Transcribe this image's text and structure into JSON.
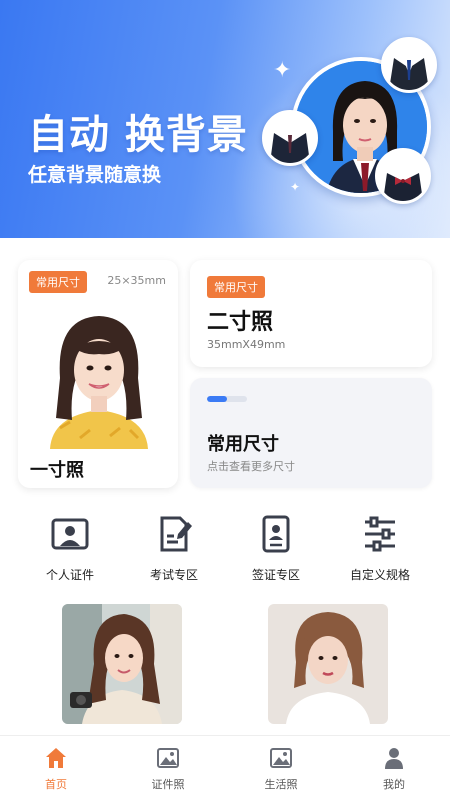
{
  "banner": {
    "title": "自动 换背景",
    "subtitle": "任意背景随意换"
  },
  "cards": {
    "one_inch": {
      "tag": "常用尺寸",
      "size": "25×35mm",
      "title": "一寸照"
    },
    "two_inch": {
      "tag": "常用尺寸",
      "title": "二寸照",
      "size": "35mmX49mm"
    },
    "common": {
      "title": "常用尺寸",
      "subtitle": "点击查看更多尺寸",
      "progress": 0.5
    }
  },
  "quick_entries": [
    {
      "label": "个人证件",
      "icon": "id-photo-icon"
    },
    {
      "label": "考试专区",
      "icon": "exam-icon"
    },
    {
      "label": "签证专区",
      "icon": "visa-icon"
    },
    {
      "label": "自定义规格",
      "icon": "custom-size-icon"
    }
  ],
  "tabbar": [
    {
      "label": "首页",
      "icon": "home-icon",
      "active": true
    },
    {
      "label": "证件照",
      "icon": "image-icon",
      "active": false
    },
    {
      "label": "生活照",
      "icon": "image-icon",
      "active": false
    },
    {
      "label": "我的",
      "icon": "user-icon",
      "active": false
    }
  ],
  "colors": {
    "accent": "#f07a3a",
    "primary_blue": "#3b7bf5",
    "banner_start": "#3a78f2",
    "banner_end": "#dbe8fd"
  }
}
